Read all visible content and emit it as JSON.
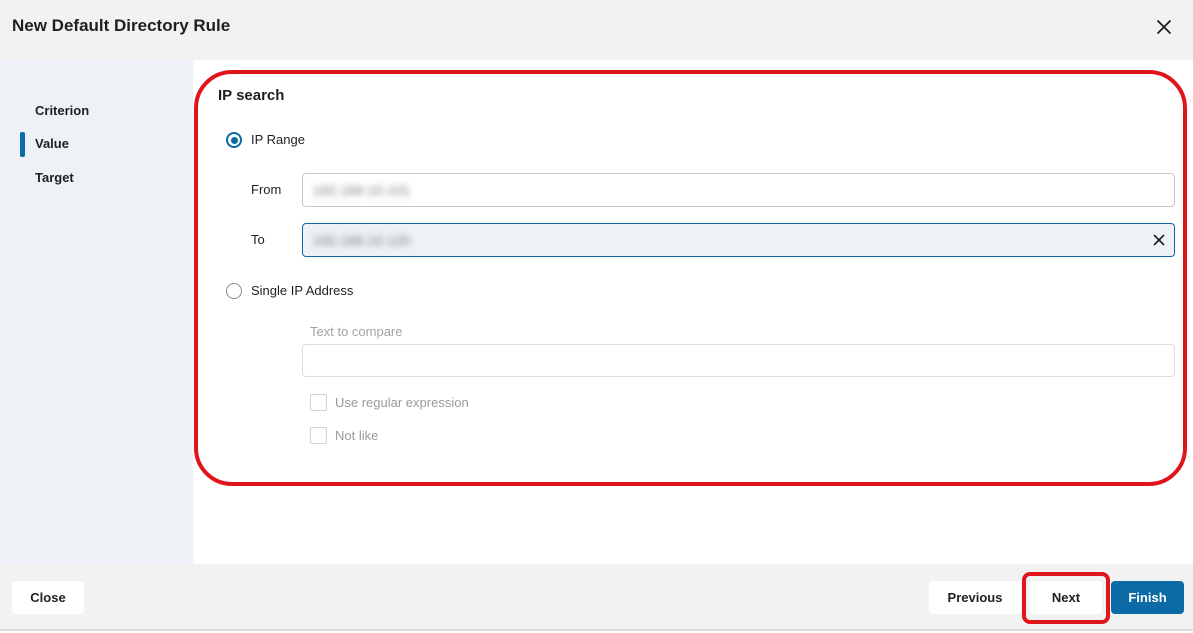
{
  "dialog": {
    "title": "New Default Directory Rule",
    "close_icon": "close-icon"
  },
  "sidebar": {
    "items": [
      {
        "label": "Criterion",
        "active": false
      },
      {
        "label": "Value",
        "active": true
      },
      {
        "label": "Target",
        "active": false
      }
    ]
  },
  "ip_search": {
    "title": "IP search",
    "ip_range": {
      "label": "IP Range",
      "selected": true,
      "from_label": "From",
      "from_value": "192.168.10.101",
      "to_label": "To",
      "to_value": "192.168.10.120"
    },
    "single_ip": {
      "label": "Single IP Address",
      "selected": false,
      "compare_label": "Text to compare",
      "compare_value": "",
      "use_regex_label": "Use regular expression",
      "not_like_label": "Not like"
    }
  },
  "footer": {
    "close_label": "Close",
    "previous_label": "Previous",
    "next_label": "Next",
    "finish_label": "Finish"
  },
  "colors": {
    "accent": "#0c6aa6",
    "highlight": "#e0151b"
  }
}
